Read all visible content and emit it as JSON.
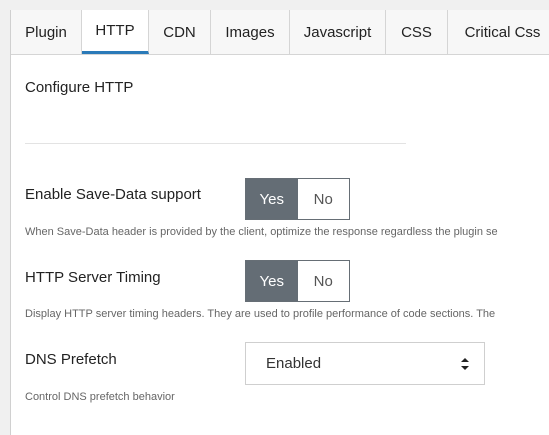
{
  "tabs": [
    {
      "label": "Plugin"
    },
    {
      "label": "HTTP"
    },
    {
      "label": "CDN"
    },
    {
      "label": "Images"
    },
    {
      "label": "Javascript"
    },
    {
      "label": "CSS"
    },
    {
      "label": "Critical Css"
    }
  ],
  "active_tab": "HTTP",
  "section": {
    "title": "Configure HTTP"
  },
  "options": {
    "save_data": {
      "label": "Enable Save-Data support",
      "description": "When Save-Data header is provided by the client, optimize the response regardless the plugin se",
      "yes": "Yes",
      "no": "No",
      "selected": "Yes"
    },
    "server_timing": {
      "label": "HTTP Server Timing",
      "description": "Display HTTP server timing headers. They are used to profile performance of code sections. The",
      "yes": "Yes",
      "no": "No",
      "selected": "Yes"
    },
    "dns_prefetch": {
      "label": "DNS Prefetch",
      "value": "Enabled",
      "description": "Control DNS prefetch behavior"
    }
  },
  "colors": {
    "accent": "#2a7ab8",
    "toggle_on": "#646d75"
  },
  "icons": {
    "select_arrows": "sort-arrows-icon"
  }
}
